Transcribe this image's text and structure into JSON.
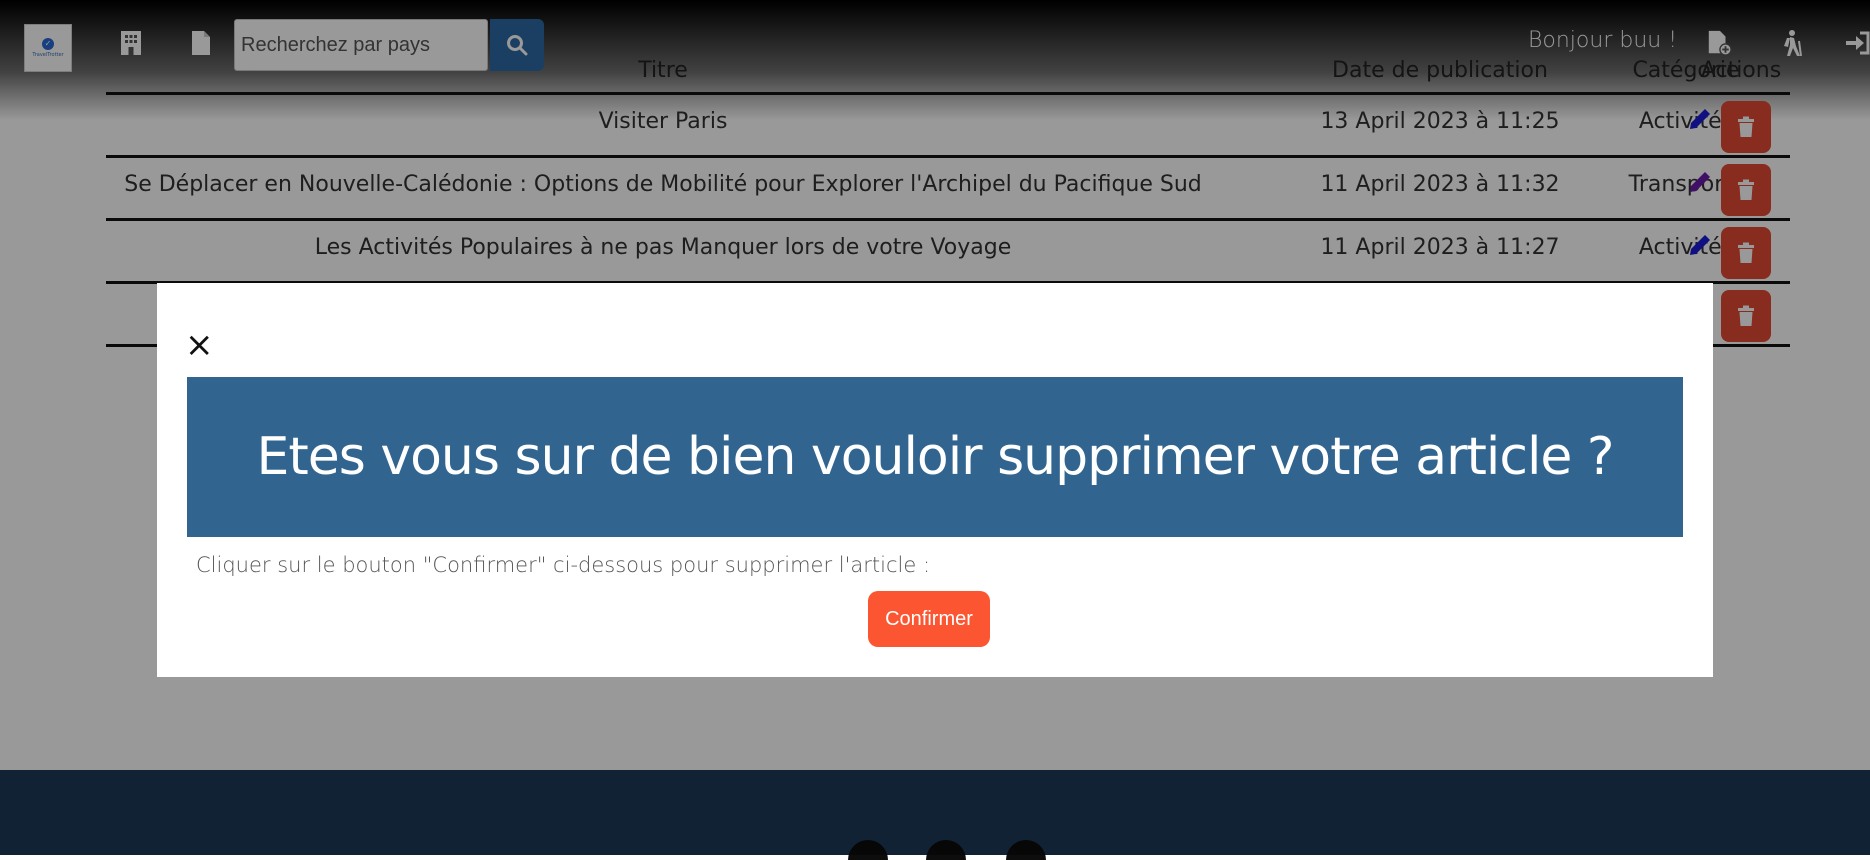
{
  "navbar": {
    "logo_text": "TravelTrotter",
    "search_placeholder": "Recherchez par pays",
    "greeting": "Bonjour buu !"
  },
  "table": {
    "headers": {
      "title": "Titre",
      "date": "Date de publication",
      "category": "Catégorie",
      "actions": "Actions"
    },
    "rows": [
      {
        "title": "Visiter Paris",
        "date": "13 April 2023 à 11:25",
        "category": "Activités",
        "edit_color": "#1b1bd6"
      },
      {
        "title": "Se Déplacer en Nouvelle-Calédonie : Options de Mobilité pour Explorer l'Archipel du Pacifique Sud",
        "date": "11 April 2023 à 11:32",
        "category": "Transports",
        "edit_color": "#6a1ba8"
      },
      {
        "title": "Les Activités Populaires à ne pas Manquer lors de votre Voyage",
        "date": "11 April 2023 à 11:27",
        "category": "Activités",
        "edit_color": "#1b1bd6"
      },
      {
        "title": "",
        "date": "",
        "category": "",
        "edit_color": "#1b1bd6"
      }
    ]
  },
  "modal": {
    "title": "Etes vous sur de bien vouloir supprimer votre article ?",
    "text": "Cliquer sur le bouton \"Confirmer\" ci-dessous pour supprimer l'article :",
    "confirm_label": "Confirmer",
    "header_color": "#31658f",
    "confirm_color": "#fb5532"
  },
  "footer": {
    "color": "#1b3a55"
  }
}
